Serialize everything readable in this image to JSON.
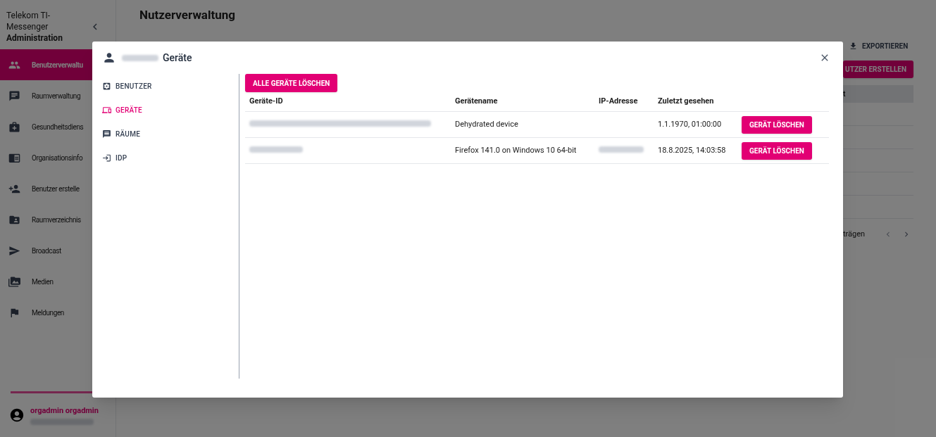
{
  "app": {
    "title_line": "Telekom TI-Messenger",
    "subtitle": "Administration"
  },
  "sidebar": {
    "items": [
      {
        "label": "Benutzerverwaltu",
        "selected": true
      },
      {
        "label": "Raumverwaltung",
        "selected": false
      },
      {
        "label": "Gesundheitsdiens",
        "selected": false
      },
      {
        "label": "Organisationsinfo",
        "selected": false
      },
      {
        "label": "Benutzer erstelle",
        "selected": false
      },
      {
        "label": "Raumverzeichnis",
        "selected": false
      },
      {
        "label": "Broadcast",
        "selected": false
      },
      {
        "label": "Medien",
        "selected": false
      },
      {
        "label": "Meldungen",
        "selected": false
      }
    ],
    "user": {
      "name": "orgadmin orgadmin"
    }
  },
  "page": {
    "title": "Nutzerverwaltung",
    "export_button": "EXPORTIEREN",
    "create_button": "UTZER ERSTELLEN",
    "table_header_fragment": "t",
    "pagination_fragment": "trägen"
  },
  "dialog": {
    "title": "Geräte",
    "tabs": [
      {
        "label": "BENUTZER",
        "selected": false
      },
      {
        "label": "GERÄTE",
        "selected": true
      },
      {
        "label": "RÄUME",
        "selected": false
      },
      {
        "label": "IDP",
        "selected": false
      }
    ],
    "delete_all_button": "ALLE GERÄTE LÖSCHEN",
    "table": {
      "columns": [
        "Geräte-ID",
        "Gerätename",
        "IP-Adresse",
        "Zuletzt gesehen"
      ],
      "rows": [
        {
          "name": "Dehydrated device",
          "ip_shown": false,
          "last_seen": "1.1.1970, 01:00:00",
          "action": "GERÄT LÖSCHEN"
        },
        {
          "name": "Firefox 141.0 on Windows 10 64-bit",
          "ip_shown": true,
          "last_seen": "18.8.2025, 14:03:58",
          "action": "GERÄT LÖSCHEN"
        }
      ]
    }
  }
}
